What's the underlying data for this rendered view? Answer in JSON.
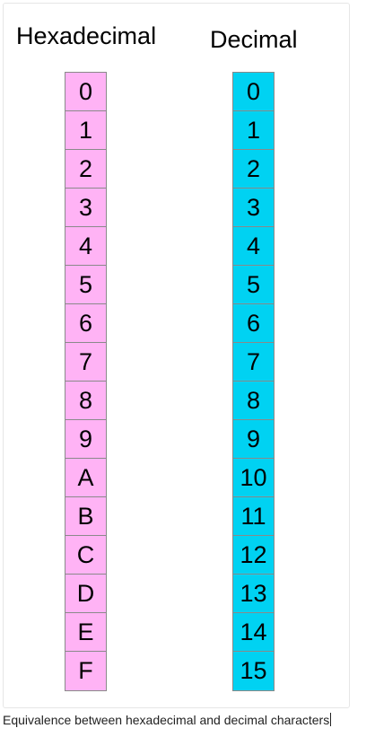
{
  "headers": {
    "hex": "Hexadecimal",
    "dec": "Decimal"
  },
  "hex_values": [
    "0",
    "1",
    "2",
    "3",
    "4",
    "5",
    "6",
    "7",
    "8",
    "9",
    "A",
    "B",
    "C",
    "D",
    "E",
    "F"
  ],
  "dec_values": [
    "0",
    "1",
    "2",
    "3",
    "4",
    "5",
    "6",
    "7",
    "8",
    "9",
    "10",
    "11",
    "12",
    "13",
    "14",
    "15"
  ],
  "caption": "Equivalence between hexadecimal and decimal characters",
  "colors": {
    "hex_cell": "#ffb3f5",
    "dec_cell": "#00d2f2",
    "cell_border": "#8a8a8a"
  }
}
